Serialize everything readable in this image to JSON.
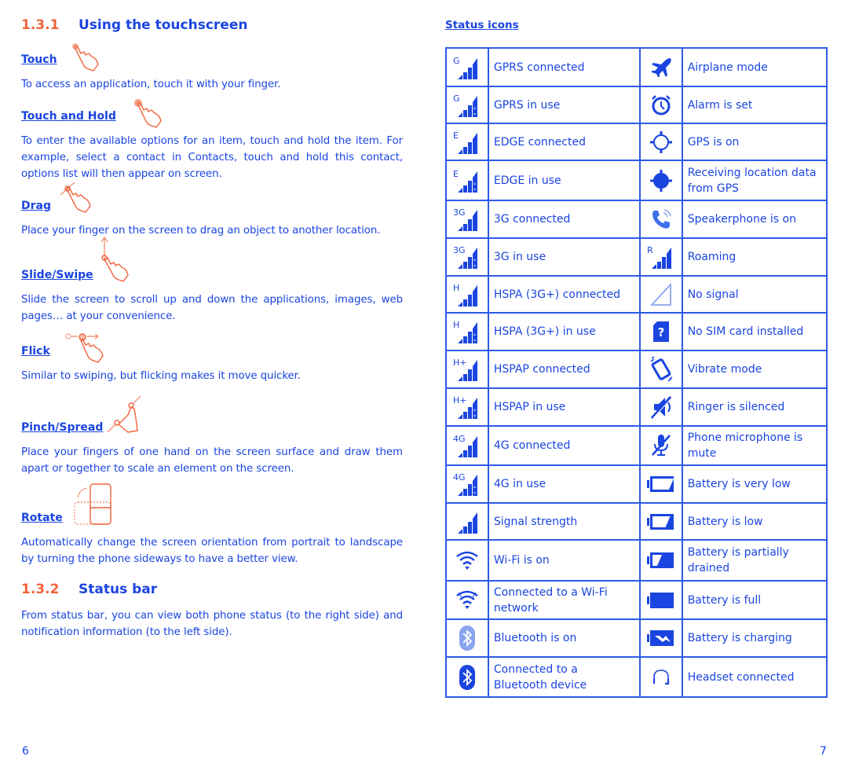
{
  "left_page": {
    "section1": {
      "number": "1.3.1",
      "title": "Using the touchscreen"
    },
    "gestures": [
      {
        "id": "touch",
        "title": "Touch",
        "icon": "hand-touch-icon",
        "text": "To access an application, touch it with your finger."
      },
      {
        "id": "touch-hold",
        "title": "Touch and Hold",
        "icon": "hand-touch-hold-icon",
        "text": "To enter the available options for an item, touch and hold the item. For example, select a contact in Contacts, touch and hold this contact, options list will then appear on screen."
      },
      {
        "id": "drag",
        "title": "Drag",
        "icon": "hand-drag-icon",
        "text": "Place your finger on the screen to drag an object to another location."
      },
      {
        "id": "slide",
        "title": "Slide/Swipe",
        "icon": "hand-swipe-icon",
        "text": "Slide the screen to scroll up and down the applications, images, web pages… at your convenience."
      },
      {
        "id": "flick",
        "title": "Flick",
        "icon": "hand-flick-icon",
        "text": "Similar to swiping, but flicking makes it move quicker."
      },
      {
        "id": "pinch",
        "title": "Pinch/Spread",
        "icon": "hand-pinch-icon",
        "text": "Place your fingers of one hand on the screen surface and draw them apart or together to scale an element on the screen."
      },
      {
        "id": "rotate",
        "title": "Rotate",
        "icon": "rotate-phone-icon",
        "text": "Automatically change the screen orientation from portrait to landscape by turning the phone sideways to have a better view."
      }
    ],
    "section2": {
      "number": "1.3.2",
      "title": "Status bar",
      "text": "From status bar, you can view both phone status (to the right side) and notification information (to the left side)."
    },
    "page_number": "6"
  },
  "right_page": {
    "title": "Status icons",
    "rows": [
      {
        "left": {
          "icon": "signal-g-icon",
          "label": "GPRS connected"
        },
        "right": {
          "icon": "airplane-icon",
          "label": "Airplane mode"
        }
      },
      {
        "left": {
          "icon": "signal-g-inuse-icon",
          "label": "GPRS in use"
        },
        "right": {
          "icon": "alarm-clock-icon",
          "label": "Alarm is set"
        }
      },
      {
        "left": {
          "icon": "signal-e-icon",
          "label": "EDGE connected"
        },
        "right": {
          "icon": "gps-icon",
          "label": "GPS is on"
        }
      },
      {
        "left": {
          "icon": "signal-e-inuse-icon",
          "label": "EDGE in use"
        },
        "right": {
          "icon": "gps-receiving-icon",
          "label": "Receiving location data from GPS"
        }
      },
      {
        "left": {
          "icon": "signal-3g-icon",
          "label": "3G connected"
        },
        "right": {
          "icon": "speakerphone-icon",
          "label": "Speakerphone is on"
        }
      },
      {
        "left": {
          "icon": "signal-3g-inuse-icon",
          "label": "3G in use"
        },
        "right": {
          "icon": "roaming-icon",
          "label": "Roaming"
        }
      },
      {
        "left": {
          "icon": "signal-h-icon",
          "label": "HSPA (3G+) connected"
        },
        "right": {
          "icon": "no-signal-icon",
          "label": "No signal"
        }
      },
      {
        "left": {
          "icon": "signal-h-inuse-icon",
          "label": "HSPA (3G+) in use"
        },
        "right": {
          "icon": "no-sim-icon",
          "label": "No SIM card installed"
        }
      },
      {
        "left": {
          "icon": "signal-hplus-icon",
          "label": "HSPAP connected"
        },
        "right": {
          "icon": "vibrate-icon",
          "label": "Vibrate mode"
        }
      },
      {
        "left": {
          "icon": "signal-hplus-inuse-icon",
          "label": "HSPAP in use"
        },
        "right": {
          "icon": "ringer-silenced-icon",
          "label": "Ringer is silenced"
        }
      },
      {
        "left": {
          "icon": "signal-4g-icon",
          "label": "4G connected"
        },
        "right": {
          "icon": "mic-mute-icon",
          "label": "Phone microphone is mute"
        }
      },
      {
        "left": {
          "icon": "signal-4g-inuse-icon",
          "label": "4G in use"
        },
        "right": {
          "icon": "battery-very-low-icon",
          "label": "Battery is very low"
        }
      },
      {
        "left": {
          "icon": "signal-strength-icon",
          "label": "Signal strength"
        },
        "right": {
          "icon": "battery-low-icon",
          "label": "Battery is low"
        }
      },
      {
        "left": {
          "icon": "wifi-on-icon",
          "label": "Wi-Fi is on"
        },
        "right": {
          "icon": "battery-partial-icon",
          "label": "Battery is partially drained"
        }
      },
      {
        "left": {
          "icon": "wifi-connected-icon",
          "label": "Connected to a Wi-Fi network"
        },
        "right": {
          "icon": "battery-full-icon",
          "label": "Battery is full"
        }
      },
      {
        "left": {
          "icon": "bluetooth-on-icon",
          "label": "Bluetooth is on"
        },
        "right": {
          "icon": "battery-charging-icon",
          "label": "Battery is charging"
        }
      },
      {
        "left": {
          "icon": "bluetooth-connected-icon",
          "label": "Connected to a Bluetooth device"
        },
        "right": {
          "icon": "headset-icon",
          "label": "Headset connected"
        }
      }
    ],
    "page_number": "7"
  },
  "colors": {
    "text_blue": "#1a45e0",
    "accent_orange": "#f0643c",
    "table_border": "#2f5ae8"
  }
}
